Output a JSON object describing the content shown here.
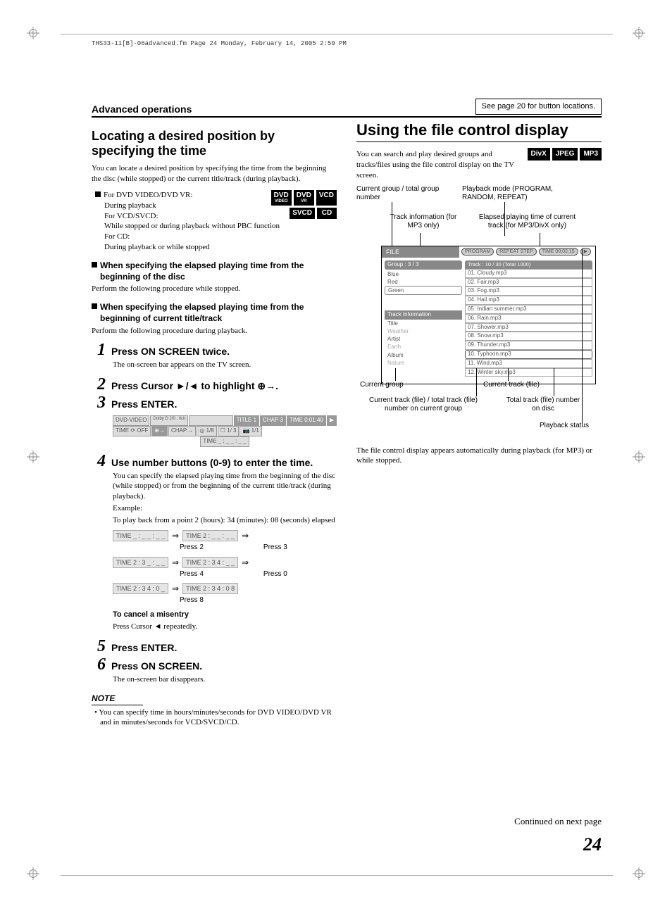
{
  "header_file_line": "THS33-11[B]-06advanced.fm  Page 24  Monday, February 14, 2005  2:59 PM",
  "section_label": "Advanced operations",
  "button_loc_note": "See page 20 for button locations.",
  "left": {
    "title": "Locating a desired position by specifying the time",
    "intro": "You can locate a desired position by specifying the time from the beginning the disc (while stopped) or the current title/track (during playback).",
    "disc_notes": [
      "For DVD VIDEO/DVD VR:",
      "During playback",
      "For VCD/SVCD:",
      "While stopped or during playback without PBC function",
      "For CD:",
      "During playback or while stopped"
    ],
    "badges_row1": [
      "DVD VIDEO",
      "DVD VR",
      "VCD"
    ],
    "badges_row2": [
      "SVCD",
      "CD"
    ],
    "sh1": "When specifying the elapsed playing time from the beginning of the disc",
    "sh1_body": "Perform the following procedure while stopped.",
    "sh2": "When specifying the elapsed playing time from the beginning of current title/track",
    "sh2_body": "Perform the following procedure during playback.",
    "step1": "Press ON SCREEN twice.",
    "step1_body": "The on-screen bar appears on the TV screen.",
    "step2": "Press Cursor ►/◄ to highlight ⊕→.",
    "step3": "Press ENTER.",
    "osd_r1": [
      "DVD-VIDEO",
      "Dolby D 2/0 . 0ch",
      "",
      "TITLE 1",
      "CHAP 3",
      "TIME 0:01:40",
      "▶"
    ],
    "osd_r2": [
      "TIME ⟳ OFF",
      "⊕→",
      "CHAP.→",
      "◎ 1/8",
      "☐ 1/ 3",
      "📷 1/1"
    ],
    "osd_r3": "TIME  _ : _ _ : _ _",
    "step4": "Use number buttons (0-9) to enter the time.",
    "step4_body1": "You can specify the elapsed playing time from the beginning of the disc (while stopped) or from the beginning of the current title/track (during playback).",
    "example_label": "Example:",
    "example_body": "To play back from a point 2 (hours): 34 (minutes): 08 (seconds) elapsed",
    "time_seq": [
      {
        "a": "TIME  _ : _ _ : _ _",
        "b": "TIME  2 : _ _ : _ _",
        "la": "Press 2",
        "lb": "Press 3"
      },
      {
        "a": "TIME  2 : 3 _ : _ _",
        "b": "TIME  2 : 3 4 : _ _",
        "la": "Press 4",
        "lb": "Press 0"
      },
      {
        "a": "TIME  2 : 3 4 : 0 _",
        "b": "TIME  2 : 3 4 : 0 8",
        "la": "Press 8",
        "lb": ""
      }
    ],
    "cancel_hd": "To cancel a misentry",
    "cancel_body": "Press Cursor ◄ repeatedly.",
    "step5": "Press ENTER.",
    "step6": "Press ON SCREEN.",
    "step6_body": "The on-screen bar disappears.",
    "note_label": "NOTE",
    "note1": "You can specify time in hours/minutes/seconds for DVD VIDEO/DVD VR and in minutes/seconds for VCD/SVCD/CD."
  },
  "right": {
    "title": "Using the file control display",
    "intro": "You can search and play desired groups and tracks/files using the file control display on the TV screen.",
    "badges": [
      "DivX",
      "JPEG",
      "MP3"
    ],
    "callouts": {
      "c1": "Current group / total group number",
      "c2": "Playback mode (PROGRAM, RANDOM, REPEAT)",
      "c3": "Track information (for MP3 only)",
      "c4": "Elapsed playing time of current track (for MP3/DivX only)",
      "c5": "Current group",
      "c6": "Current track (file)",
      "c7": "Current track (file) / total track (file) number on current group",
      "c8": "Total track (file) number on disc",
      "c9": "Playback status"
    },
    "file_display": {
      "file_label": "FILE",
      "status_pills": [
        "PROGRAM",
        "REPEAT STEP",
        "TIME 00:02:15"
      ],
      "group_header": "Group : 3 / 3",
      "groups": [
        "Blue",
        "Red",
        "Green"
      ],
      "track_info_label": "Track Information",
      "info_rows": [
        {
          "k": "Title",
          "v": "Weather"
        },
        {
          "k": "Artist",
          "v": "Earth"
        },
        {
          "k": "Album",
          "v": "Nature"
        }
      ],
      "track_header": "Track : 10 / 30 (Total 1000)",
      "tracks": [
        "01. Cloudy.mp3",
        "02. Fair.mp3",
        "03. Fog.mp3",
        "04. Hail.mp3",
        "05. Indian summer.mp3",
        "06. Rain.mp3",
        "07. Shower.mp3",
        "08. Snow.mp3",
        "09. Thunder.mp3",
        "10. Typhoon.mp3",
        "11. Wind.mp3",
        "12. Winter sky.mp3"
      ]
    },
    "after": "The file control display appears automatically during playback (for MP3) or while stopped."
  },
  "continued": "Continued on next page",
  "page_number": "24"
}
